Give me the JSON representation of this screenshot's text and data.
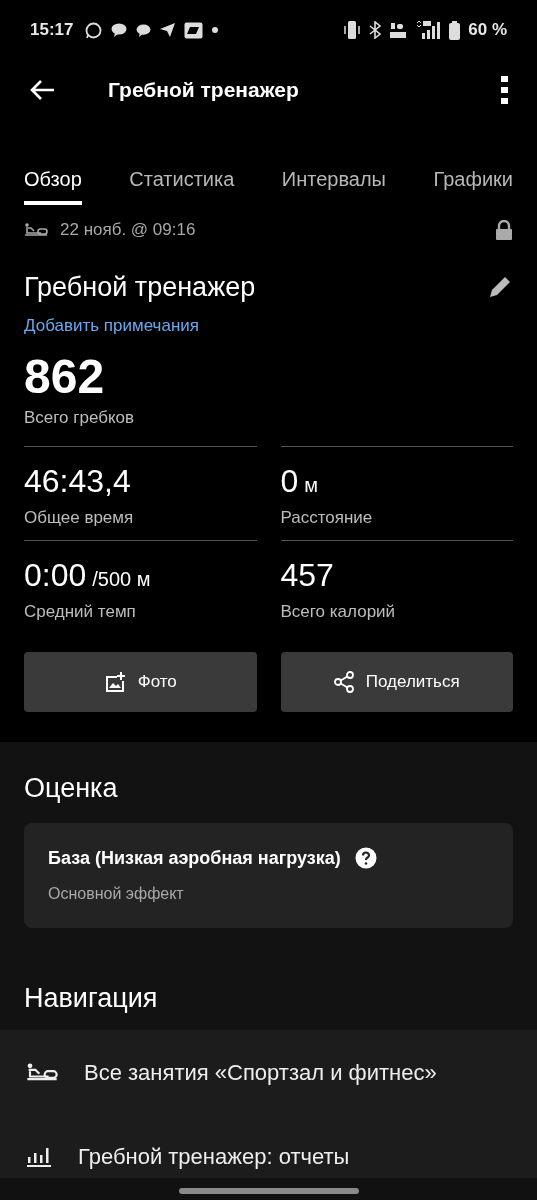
{
  "status_bar": {
    "time": "15:17",
    "battery": "60 %"
  },
  "app_bar": {
    "title": "Гребной тренажер"
  },
  "tabs": [
    {
      "label": "Обзор",
      "selected": true
    },
    {
      "label": "Статистика",
      "selected": false
    },
    {
      "label": "Интервалы",
      "selected": false
    },
    {
      "label": "Графики",
      "selected": false
    }
  ],
  "activity": {
    "date": "22 нояб. @ 09:16",
    "name": "Гребной тренажер",
    "notes_link": "Добавить примечания",
    "main_value": "862",
    "main_label": "Всего гребков"
  },
  "stats": [
    {
      "value": "46:43,4",
      "label": "Общее время"
    },
    {
      "value": "0",
      "unit": "м",
      "label": "Расстояние"
    },
    {
      "value": "0:00",
      "unit": "/500 м",
      "label": "Средний темп"
    },
    {
      "value": "457",
      "label": "Всего калорий"
    }
  ],
  "buttons": [
    {
      "kind": "photo",
      "label": "Фото"
    },
    {
      "kind": "share",
      "label": "Поделиться"
    }
  ],
  "evaluation": {
    "heading": "Оценка",
    "title": "База (Низкая аэробная нагрузка)",
    "subtitle": "Основной эффект"
  },
  "navigation": {
    "heading": "Навигация",
    "items": [
      {
        "kind": "rower",
        "label": "Все занятия «Спортзал и фитнес»"
      },
      {
        "kind": "chart",
        "label": "Гребной тренажер: отчеты"
      }
    ]
  }
}
